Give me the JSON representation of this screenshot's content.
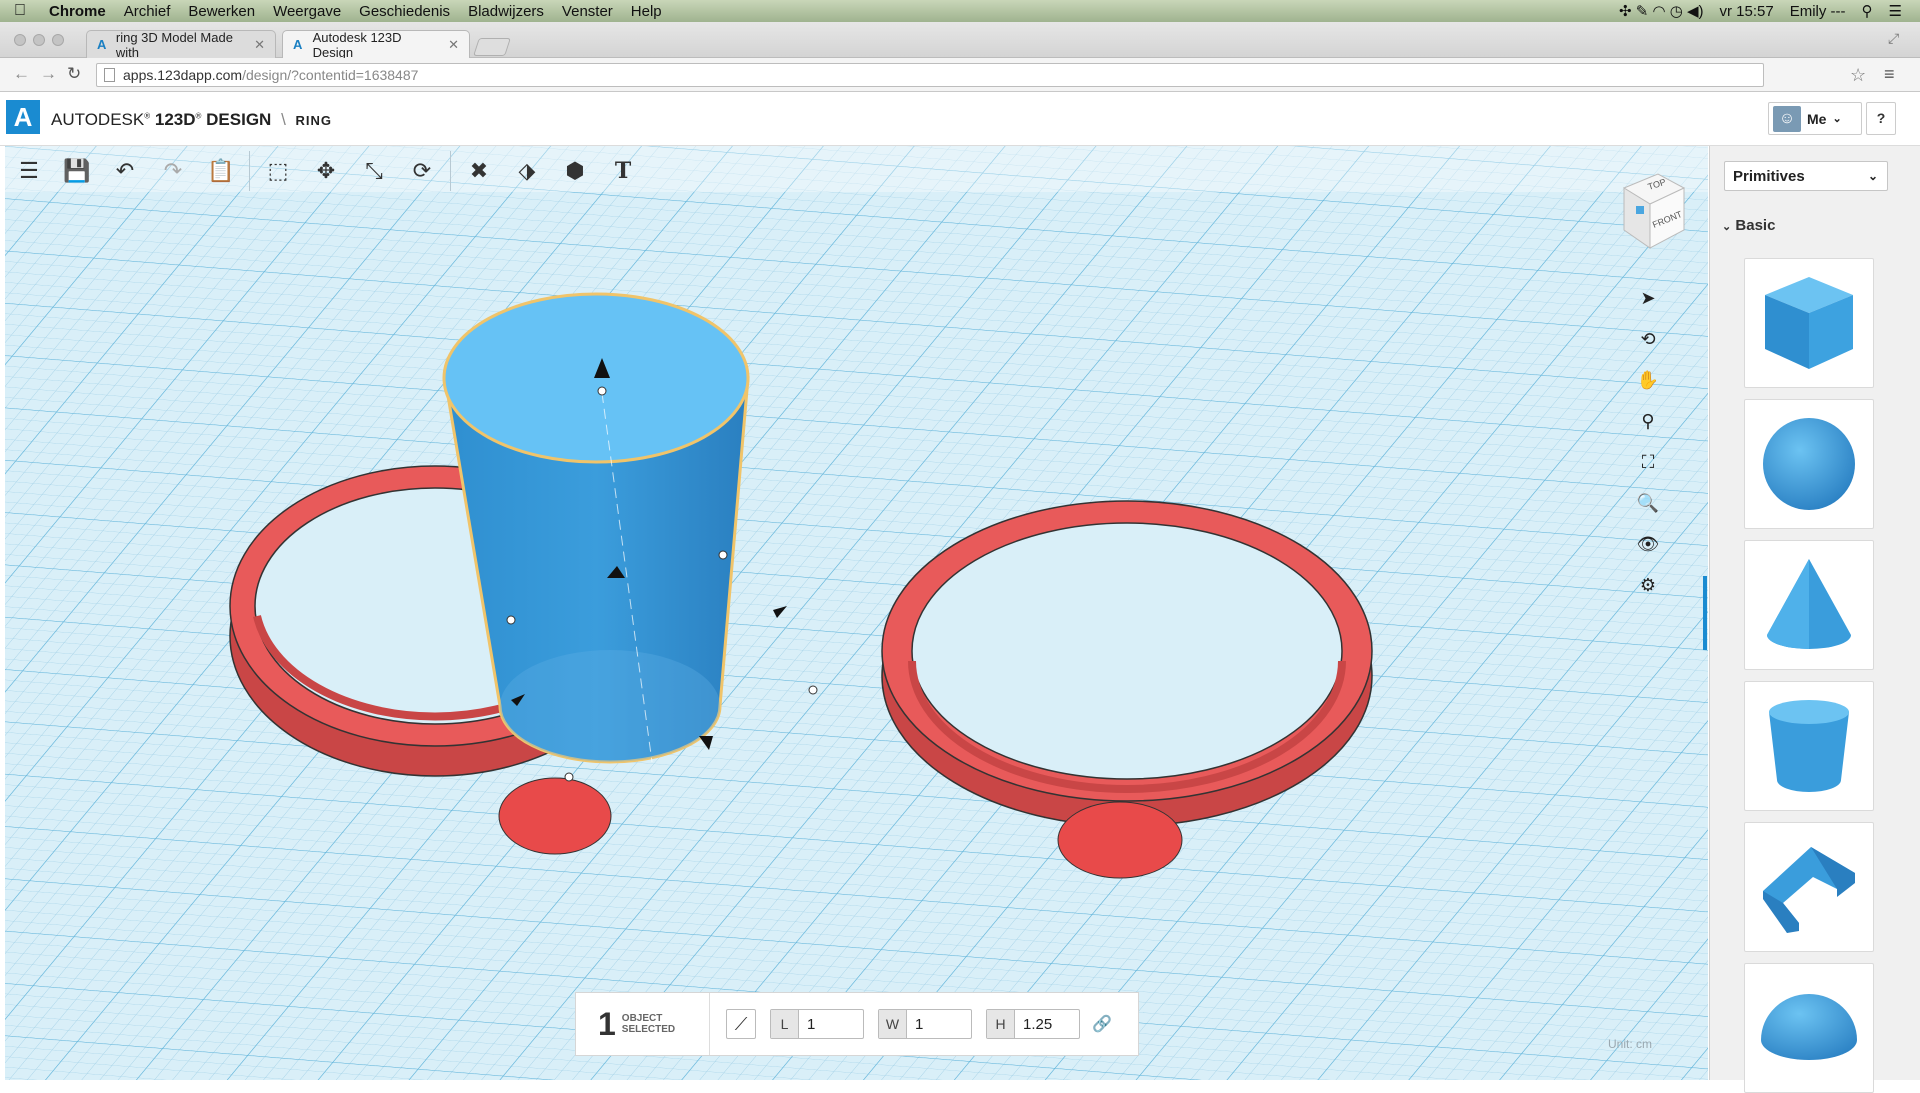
{
  "menubar": {
    "app": "Chrome",
    "items": [
      "Archief",
      "Bewerken",
      "Weergave",
      "Geschiedenis",
      "Bladwijzers",
      "Venster",
      "Help"
    ],
    "clock": "vr 15:57",
    "user": "Emily ---"
  },
  "browser": {
    "tabs": [
      {
        "title": "ring 3D Model Made with"
      },
      {
        "title": "Autodesk 123D Design"
      }
    ],
    "url_host": "apps.123dapp.com",
    "url_path": "/design/?contentid=1638487"
  },
  "app": {
    "brand_prefix": "AUTODESK",
    "brand_product": "123D",
    "brand_suffix": "DESIGN",
    "project_name": "RING",
    "user_menu": "Me",
    "help": "?"
  },
  "toolbar": {
    "icons": [
      "menu-icon",
      "save-icon",
      "undo-icon",
      "redo-icon",
      "paste-icon",
      "transform-bounds-icon",
      "move-icon",
      "scale-icon",
      "rotate-icon",
      "tweak-icon",
      "construct-icon",
      "combine-icon",
      "text-icon"
    ]
  },
  "viewcube": {
    "top": "TOP",
    "front": "FRONT"
  },
  "side_tools": [
    "select-icon",
    "orbit-icon",
    "pan-icon",
    "zoom-icon",
    "fit-icon",
    "zoom-selected-icon",
    "visibility-icon",
    "materials-icon"
  ],
  "selection": {
    "count": "1",
    "label_line1": "OBJECT",
    "label_line2": "SELECTED",
    "l_label": "L",
    "l_value": "1",
    "w_label": "W",
    "w_value": "1",
    "h_label": "H",
    "h_value": "1.25"
  },
  "unit_label": "Unit:  cm",
  "primitives_panel": {
    "selected": "Primitives",
    "section": "Basic",
    "items": [
      "box",
      "sphere",
      "cone",
      "cylinder",
      "polygon",
      "hemisphere"
    ]
  },
  "colors": {
    "accent": "#1a8bd1",
    "ring": "#e85a5a",
    "cylinder": "#4aa6e0",
    "grid_bg": "#d9eff8"
  }
}
